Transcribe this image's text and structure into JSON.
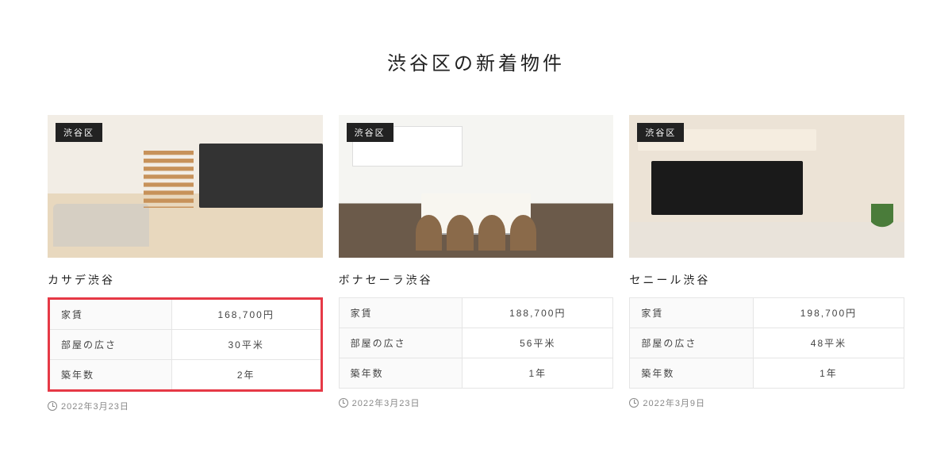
{
  "heading": "渋谷区の新着物件",
  "specLabels": {
    "rent": "家賃",
    "size": "部屋の広さ",
    "age": "築年数"
  },
  "listings": [
    {
      "badge": "渋谷区",
      "title": "カサデ渋谷",
      "rent": "168,700円",
      "size": "30平米",
      "age": "2年",
      "date": "2022年3月23日",
      "highlighted": true
    },
    {
      "badge": "渋谷区",
      "title": "ボナセーラ渋谷",
      "rent": "188,700円",
      "size": "56平米",
      "age": "1年",
      "date": "2022年3月23日",
      "highlighted": false
    },
    {
      "badge": "渋谷区",
      "title": "セニール渋谷",
      "rent": "198,700円",
      "size": "48平米",
      "age": "1年",
      "date": "2022年3月9日",
      "highlighted": false
    }
  ]
}
